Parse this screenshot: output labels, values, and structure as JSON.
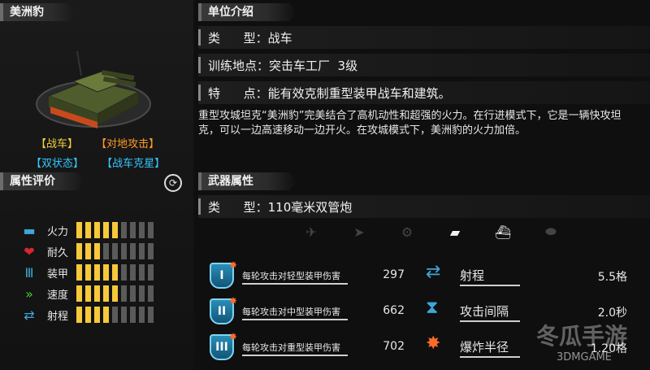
{
  "left": {
    "unit_name": "美洲豹",
    "tags": [
      {
        "label": "【战车】",
        "color": "#f3d13d"
      },
      {
        "label": "【对地攻击】",
        "color": "#ff9a24"
      },
      {
        "label": "【双状态】",
        "color": "#33c7ff"
      },
      {
        "label": "【战车克星】",
        "color": "#33c7ff"
      }
    ],
    "attr_title": "属性评价",
    "stats": [
      {
        "label": "火力",
        "icon": "firepower-icon",
        "filled": 5,
        "total": 9
      },
      {
        "label": "耐久",
        "icon": "heart-icon",
        "filled": 3,
        "total": 9
      },
      {
        "label": "装甲",
        "icon": "armor-icon",
        "filled": 5,
        "total": 9
      },
      {
        "label": "速度",
        "icon": "speed-icon",
        "filled": 5,
        "total": 9
      },
      {
        "label": "射程",
        "icon": "range-icon",
        "filled": 4,
        "total": 9
      }
    ]
  },
  "right": {
    "intro_title": "单位介绍",
    "type_label": "类      型：",
    "type_value": "战车",
    "training_label": "训练地点：",
    "training_value": "突击车工厂  3级",
    "feature_label": "特      点：",
    "feature_value": "能有效克制重型装甲战车和建筑。",
    "description": "重型攻城坦克“美洲豹”完美结合了高机动性和超强的火力。在行进模式下，它是一辆快攻坦克，可以一边高速移动一边开火。在攻城模式下，美洲豹的火力加倍。",
    "weapon_title": "武器属性",
    "weapon_type_label": "类      型：",
    "weapon_type_value": "110毫米双管炮",
    "target_icons": [
      "plane-icon",
      "jet-icon",
      "helicopter-icon",
      "tank-icon",
      "ship-icon",
      "submarine-icon"
    ],
    "damage": [
      {
        "tier": "I",
        "label": "每轮攻击对轻型装甲伤害",
        "value": "297"
      },
      {
        "tier": "II",
        "label": "每轮攻击对中型装甲伤害",
        "value": "662"
      },
      {
        "tier": "III",
        "label": "每轮攻击对重型装甲伤害",
        "value": "702"
      }
    ],
    "specs": [
      {
        "label": "射程",
        "value": "5.5格"
      },
      {
        "label": "攻击间隔",
        "value": "2.0秒"
      },
      {
        "label": "爆炸半径",
        "value": "1.20格"
      }
    ],
    "watermark_text": "冬瓜手游",
    "watermark_sub": "3DMGAME"
  },
  "colors": {
    "accent_yellow": "#f7c93a",
    "tag_orange": "#ff9a24",
    "tag_cyan": "#33c7ff"
  }
}
